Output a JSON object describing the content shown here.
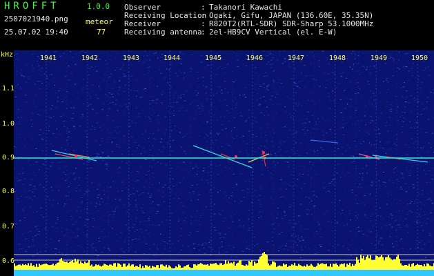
{
  "header": {
    "app_title": "HROFFT",
    "app_version": "1.0.0",
    "file_name": "2507021940.png",
    "meteor_label": "meteor",
    "date_time": "25.07.02 19:40",
    "meteor_count": "77"
  },
  "info": [
    {
      "key": "Observer",
      "value": "Takanori Kawachi"
    },
    {
      "key": "Receiving Location",
      "value": "Ogaki, Gifu, JAPAN (136.60E, 35.35N)"
    },
    {
      "key": "Receiver",
      "value": "R820T2(RTL-SDR) SDR-Sharp 53.1000MHz"
    },
    {
      "key": "Receiving antenna",
      "value": "2el-HB9CV Vertical (el. E-W)"
    }
  ],
  "info_separator": ":",
  "chart_data": {
    "type": "heatmap",
    "ylabel": "kHz",
    "x_ticks": [
      "1941",
      "1942",
      "1943",
      "1944",
      "1945",
      "1946",
      "1947",
      "1948",
      "1949",
      "1950"
    ],
    "y_ticks": [
      "1.1",
      "1.0",
      "0.9",
      "0.8",
      "0.7",
      "0.6"
    ],
    "carrier_khz": 0.9,
    "colors": {
      "background": "#0a1470",
      "carrier": "#38e8d0",
      "axis_text": "#ffff55",
      "level_bar": "#ffff33",
      "baseline": "#30c8ff"
    }
  }
}
